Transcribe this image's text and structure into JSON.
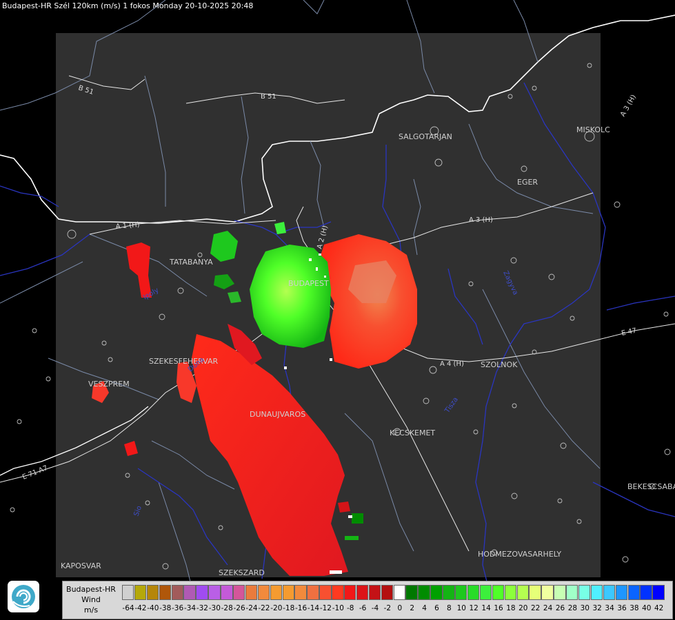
{
  "title": "Budapest-HR Szél 120km (m/s) 1 fokos Monday 20-10-2025 20:48",
  "cities": {
    "salgotarjan": "SALGOTARJAN",
    "miskolc": "MISKOLC",
    "eger": "EGER",
    "tatabanya": "TATABANYA",
    "budapest": "BUDAPEST",
    "szekesfehervar": "SZEKESFEHERVAR",
    "veszprem": "VESZPREM",
    "dunaujvaros": "DUNAUJVAROS",
    "kecskemet": "KECSKEMET",
    "szolnok": "SZOLNOK",
    "bekescsaba": "BEKESCSABA",
    "hodmezovasarhely": "HODMEZOVASARHELY",
    "kaposvar": "KAPOSVAR",
    "szekszard": "SZEKSZARD"
  },
  "roads": {
    "b51_a": "B 51",
    "b51_b": "B 51",
    "a1": "A 1 (H)",
    "a2": "A 2 (H)",
    "a3_a": "A 3 (H)",
    "a3_b": "A 3 (H)",
    "a4": "A 4 (H)",
    "e71": "E 71 A7",
    "e47": "E 47"
  },
  "rivers": {
    "duna": "Duna",
    "tisza": "Tisza",
    "sio": "Sio",
    "zagyva": "Zagyva",
    "ipoly": "Ipoly"
  },
  "legend": {
    "station": "Budapest-HR",
    "product": "Wind",
    "unit": "m/s",
    "colors": [
      "#d0d0d0",
      "#b5a80a",
      "#b5860a",
      "#b0570a",
      "#a25b5b",
      "#b05ab4",
      "#a04cf0",
      "#b95fe6",
      "#c45ad8",
      "#d4569a",
      "#ea7b3c",
      "#f28a3c",
      "#f59b30",
      "#f59b30",
      "#f28a3c",
      "#f07040",
      "#f85030",
      "#fe3a20",
      "#f21818",
      "#dc1418",
      "#c41216",
      "#b41010",
      "#ffffff",
      "#007800",
      "#008c00",
      "#00a000",
      "#14b414",
      "#1ec81e",
      "#28dc28",
      "#3cf03c",
      "#50ff28",
      "#8cff3c",
      "#b4ff50",
      "#e6ff78",
      "#f0ffa0",
      "#c8ffb4",
      "#a0ffc8",
      "#78ffe6",
      "#50f0ff",
      "#3cc8ff",
      "#1e96ff",
      "#0a64ff",
      "#0032ff",
      "#0000ff"
    ],
    "ticks": [
      "-64",
      "-42",
      "-40",
      "-38",
      "-36",
      "-34",
      "-32",
      "-30",
      "-28",
      "-26",
      "-24",
      "-22",
      "-20",
      "-18",
      "-16",
      "-14",
      "-12",
      "-10",
      "-8",
      "-6",
      "-4",
      "-2",
      "0",
      "2",
      "4",
      "6",
      "8",
      "10",
      "12",
      "14",
      "16",
      "18",
      "20",
      "22",
      "24",
      "26",
      "28",
      "30",
      "32",
      "34",
      "36",
      "38",
      "40",
      "42"
    ]
  }
}
